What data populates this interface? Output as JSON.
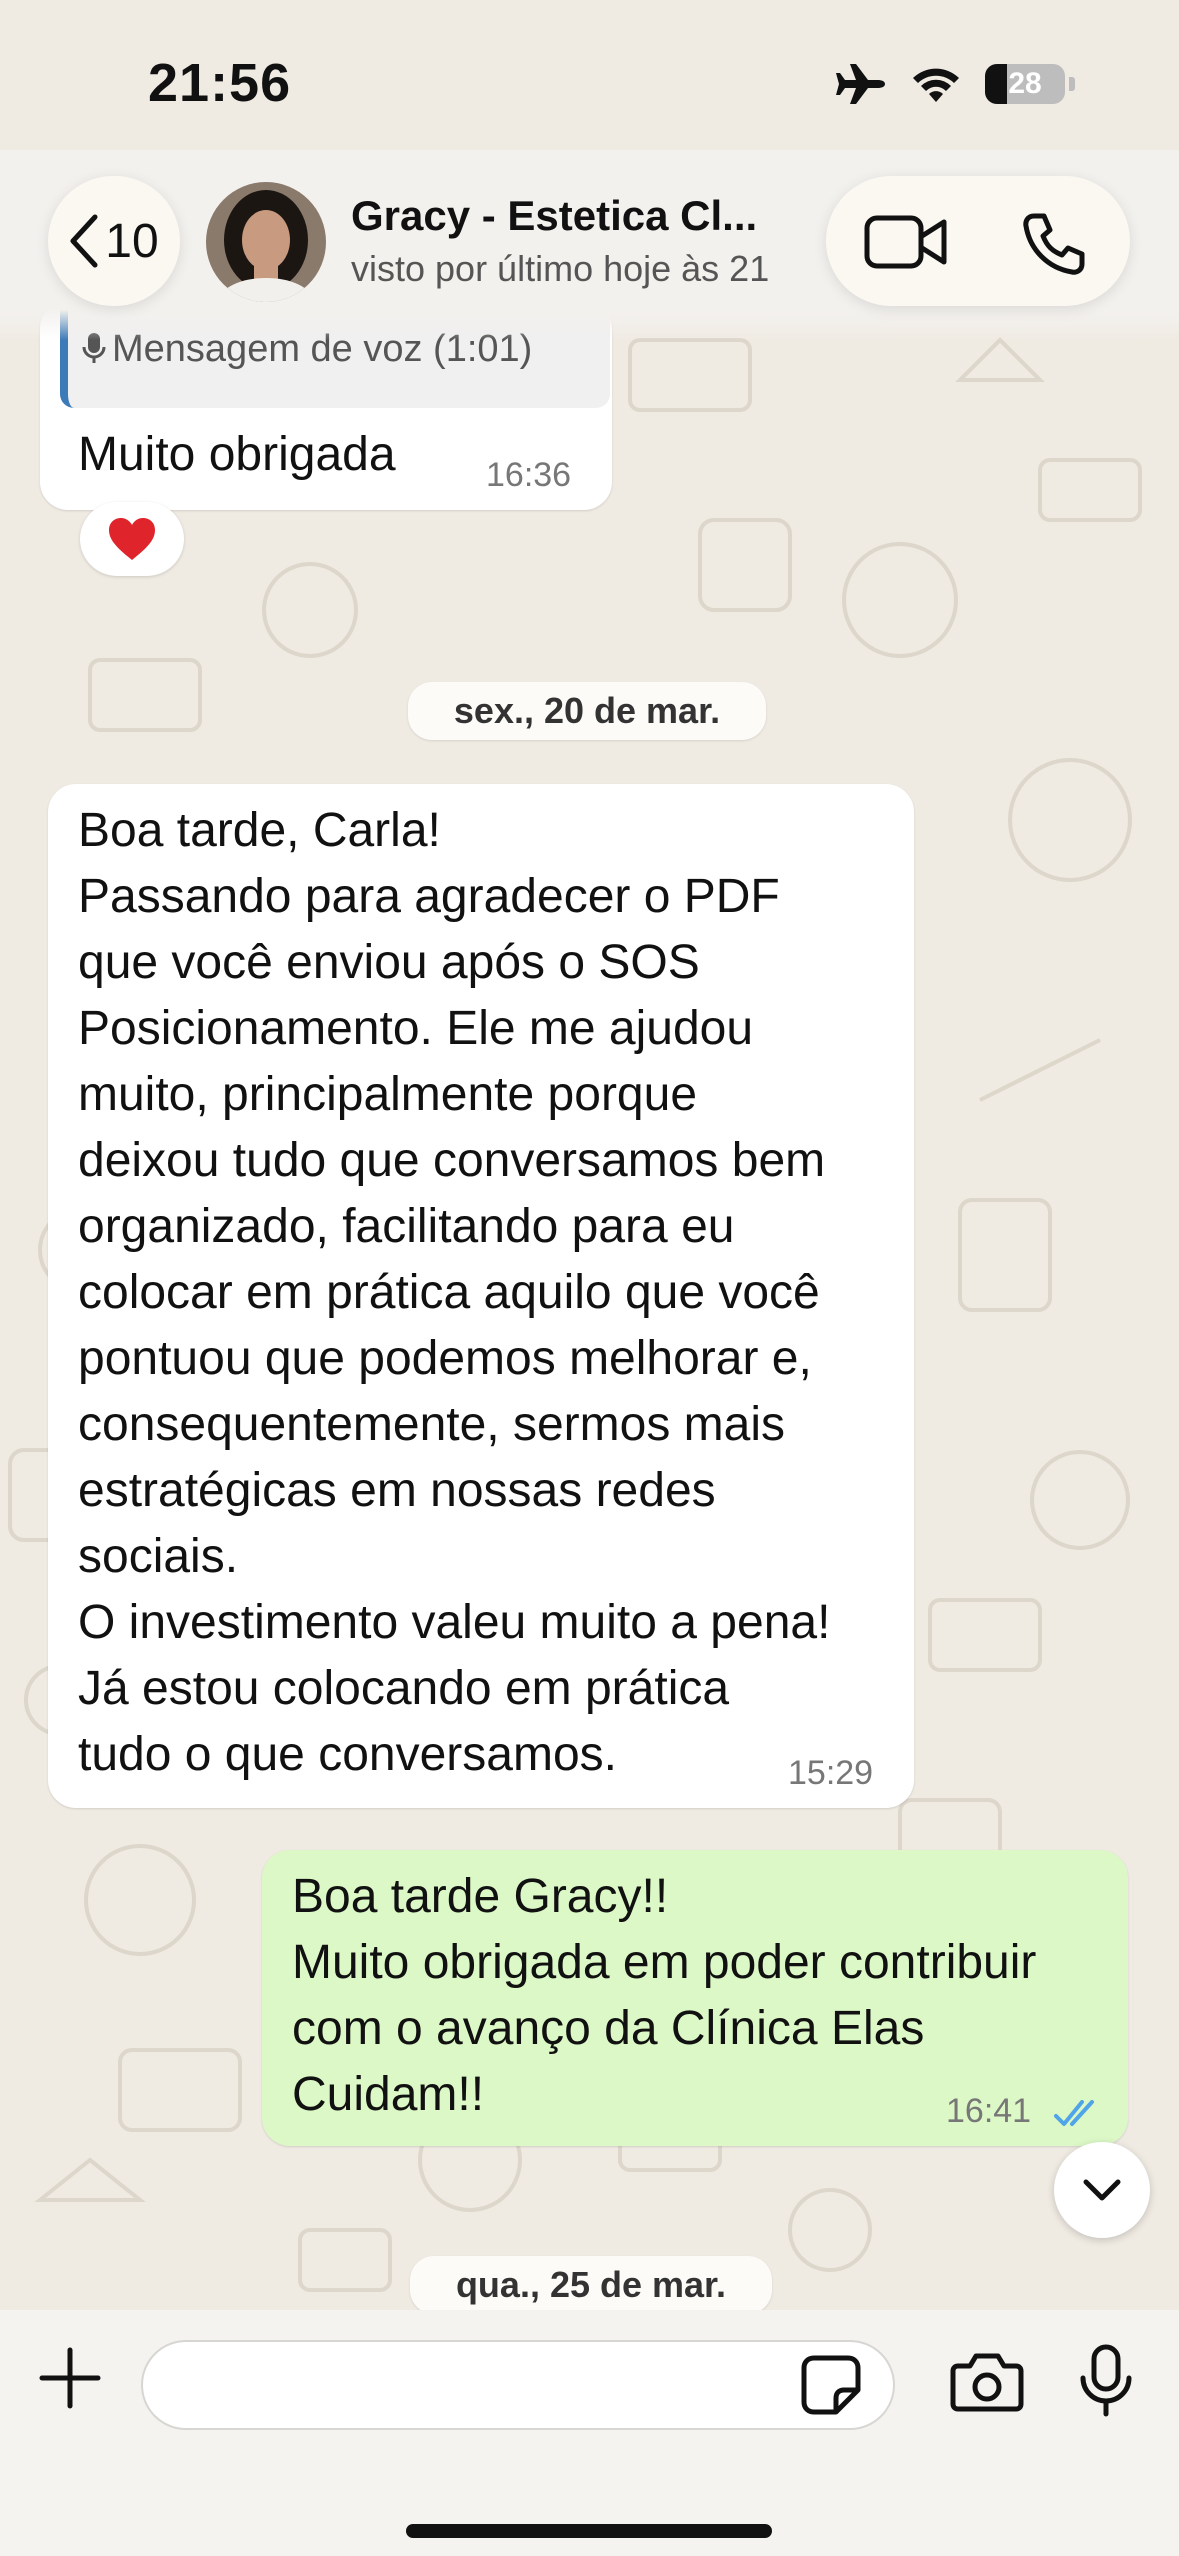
{
  "status_bar": {
    "time": "21:56",
    "battery": "28",
    "battery_fraction": 0.28
  },
  "header": {
    "back_count": "10",
    "contact_name": "Gracy - Estetica Cl...",
    "contact_status": "visto por último hoje às 21"
  },
  "messages": {
    "quoted_voice": "Mensagem de voz (1:01)",
    "msg1": {
      "text": "Muito obrigada",
      "time": "16:36",
      "reaction": "❤️"
    },
    "date1": "sex., 20 de mar.",
    "msg2": {
      "text": "Boa tarde, Carla!\nPassando para agradecer o PDF\nque você enviou após o SOS\nPosicionamento. Ele me ajudou\nmuito, principalmente porque\ndeixou tudo que conversamos bem\norganizado, facilitando para eu\ncolocar em prática aquilo que você\npontuou que podemos melhorar e,\nconsequentemente, sermos mais\nestratégicas em nossas redes\nsociais.\nO investimento valeu muito a pena!\nJá estou colocando em prática\ntudo o que conversamos.",
      "time": "15:29"
    },
    "msg3": {
      "text": "Boa tarde Gracy!!\nMuito obrigada em poder contribuir\ncom o avanço da Clínica Elas\nCuidam!!",
      "time": "16:41",
      "status": "read"
    },
    "date2": "qua., 25 de mar."
  },
  "input": {
    "placeholder": ""
  },
  "colors": {
    "chat_bg": "#efeae2",
    "incoming_bubble": "#ffffff",
    "outgoing_bubble": "#dcf8c6",
    "read_ticks": "#4fa5e8",
    "quote_bar": "#3d7bb8"
  },
  "icons": [
    "back-chevron-icon",
    "video-call-icon",
    "phone-icon",
    "mic-icon",
    "heart-icon",
    "read-ticks-icon",
    "chevron-down-icon",
    "plus-icon",
    "sticker-icon",
    "camera-icon",
    "airplane-icon",
    "wifi-icon",
    "battery-icon"
  ]
}
